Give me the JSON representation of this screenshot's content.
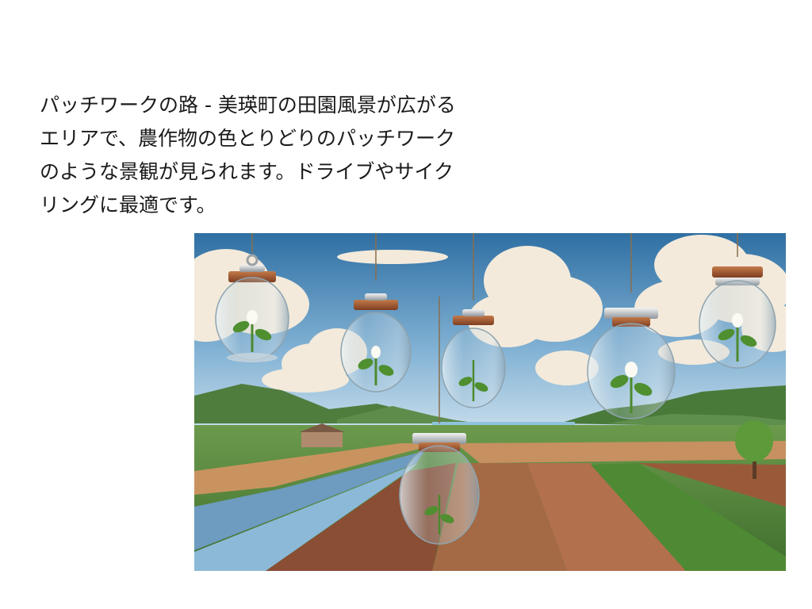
{
  "slide": {
    "body_text": "パッチワークの路 - 美瑛町の田園風景が広がるエリアで、農作物の色とりどりのパッチワークのような景観が見られます。ドライブやサイクリングに最適です。"
  },
  "illustration": {
    "subject": "hanging-glass-jars-over-patchwork-farmland",
    "colors": {
      "sky_top": "#2f6fa3",
      "sky_bottom": "#cfe2ee",
      "cloud": "#f3eadb",
      "mountain": "#4f7d3e",
      "field_green": "#4d8a3a",
      "field_brown": "#9b5b3a",
      "field_blue": "#6d9cc0",
      "jar_lid": "#a35a33"
    }
  }
}
